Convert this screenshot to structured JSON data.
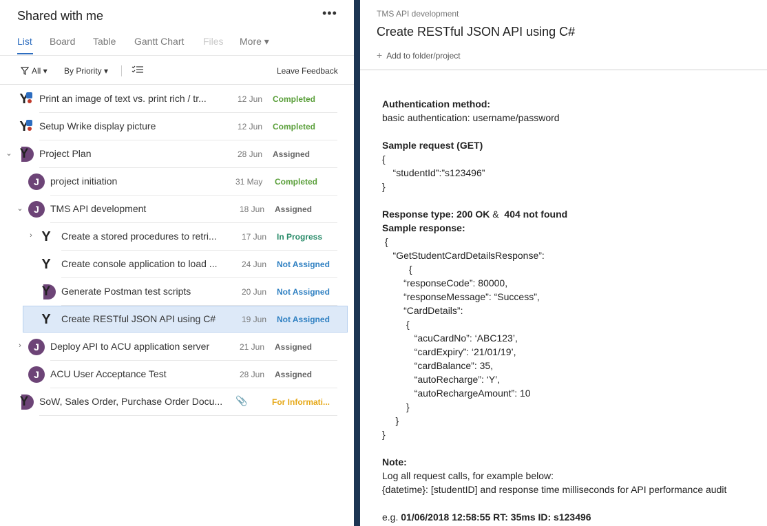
{
  "header": {
    "title": "Shared with me",
    "more_label": "•••"
  },
  "tabs": [
    {
      "label": "List"
    },
    {
      "label": "Board"
    },
    {
      "label": "Table"
    },
    {
      "label": "Gantt Chart"
    },
    {
      "label": "Files"
    },
    {
      "label": "More ▾"
    }
  ],
  "toolbar": {
    "filter_label": "All ▾",
    "sort_label": "By Priority ▾",
    "feedback_label": "Leave Feedback"
  },
  "tasks": [
    {
      "title": "Print an image of text vs. print rich / tr...",
      "date": "12 Jun",
      "status": "Completed"
    },
    {
      "title": "Setup Wrike display picture",
      "date": "12 Jun",
      "status": "Completed"
    },
    {
      "title": "Project Plan",
      "date": "28 Jun",
      "status": "Assigned"
    },
    {
      "title": "project initiation",
      "date": "31 May",
      "status": "Completed"
    },
    {
      "title": "TMS API development",
      "date": "18 Jun",
      "status": "Assigned"
    },
    {
      "title": "Create a stored procedures to retri...",
      "date": "17 Jun",
      "status": "In Progress"
    },
    {
      "title": "Create console application to load ...",
      "date": "24 Jun",
      "status": "Not Assigned"
    },
    {
      "title": "Generate Postman test scripts",
      "date": "20 Jun",
      "status": "Not Assigned"
    },
    {
      "title": "Create RESTful JSON API using C#",
      "date": "19 Jun",
      "status": "Not Assigned"
    },
    {
      "title": "Deploy API to ACU application server",
      "date": "21 Jun",
      "status": "Assigned"
    },
    {
      "title": "ACU User Acceptance Test",
      "date": "28 Jun",
      "status": "Assigned"
    },
    {
      "title": "SoW, Sales Order, Purchase Order Docu...",
      "date": "",
      "status": "For Informati..."
    }
  ],
  "detail": {
    "breadcrumb": "TMS API development",
    "title": "Create RESTful JSON API using C#",
    "add_to_folder": "Add to folder/project",
    "description": [
      "Authentication method:",
      "basic authentication: username/password",
      "",
      "Sample request (GET)",
      "{",
      "    “studentId”:”s123496”",
      "}",
      "",
      "Response type: 200 OK",
      " & ",
      " 404 not found",
      "Sample response:",
      " {",
      "    “GetStudentCardDetailsResponse”:",
      "          {",
      "        “responseCode”: 80000,",
      "        “responseMessage”: “Success”,",
      "        “CardDetails”:",
      "         {",
      "            “acuCardNo”: ‘ABC123’,",
      "            “cardExpiry”: ‘21/01/19’,",
      "            “cardBalance”: 35,",
      "            “autoRecharge”: ‘Y’,",
      "            “autoRechargeAmount”: 10",
      "         }",
      "     }",
      "}",
      "",
      "Note:",
      "Log all request calls, for example below:",
      "{datetime}: [studentID] and response time milliseconds for API performance audit",
      "",
      "e.g. ",
      "01/06/2018 12:58:55 RT: 35ms ID: s123496"
    ]
  }
}
